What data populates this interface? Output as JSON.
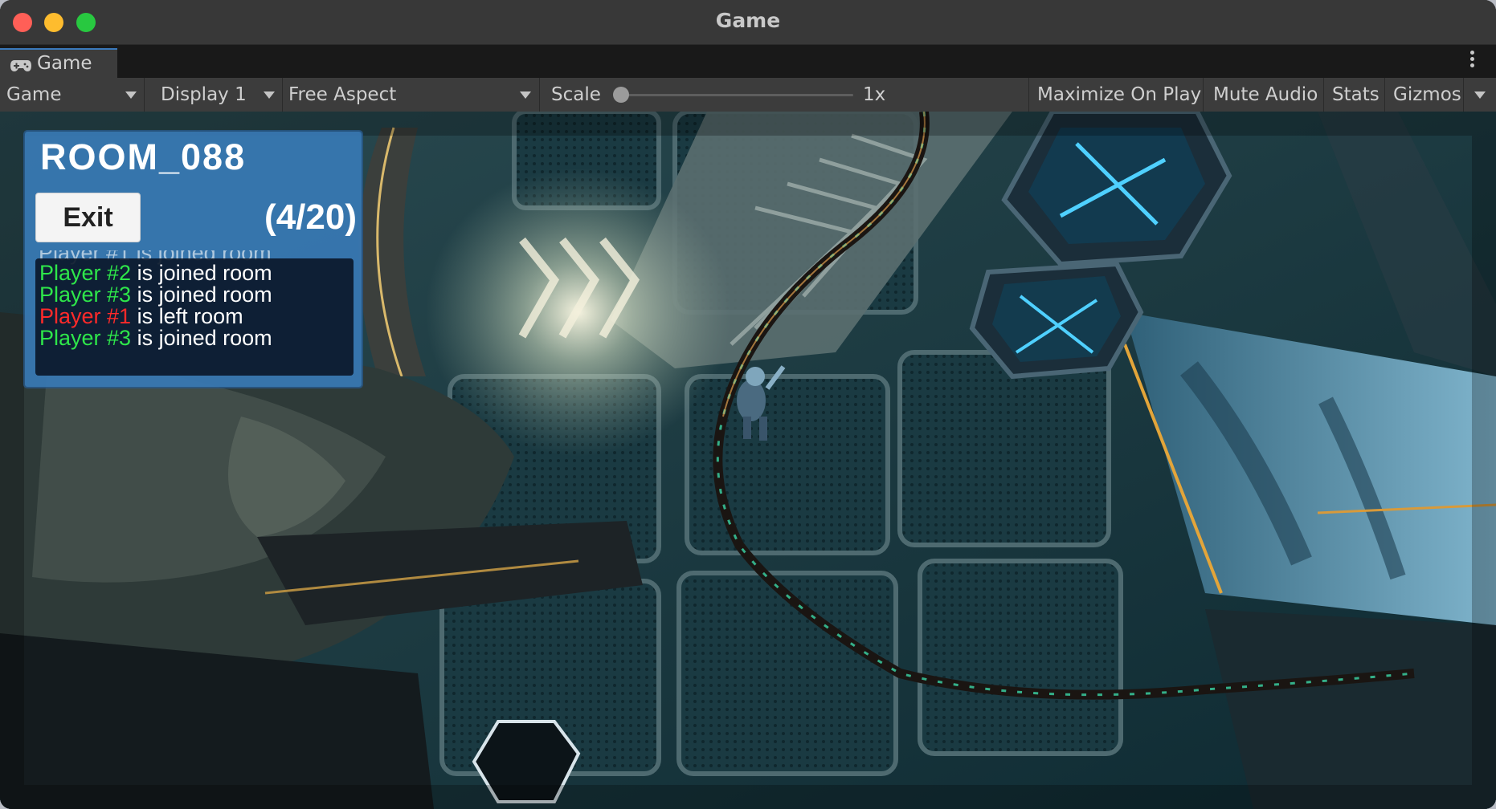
{
  "window": {
    "title": "Game"
  },
  "tab": {
    "label": "Game",
    "icon": "gamepad-icon"
  },
  "toolbar": {
    "mode": "Game",
    "display": "Display 1",
    "aspect": "Free Aspect",
    "scale_label": "Scale",
    "scale_value": "1x",
    "maximize": "Maximize On Play",
    "mute": "Mute Audio",
    "stats": "Stats",
    "gizmos": "Gizmos"
  },
  "room": {
    "name": "ROOM_088",
    "exit_label": "Exit",
    "count": "(4/20)",
    "log_ghost": "Player #1 is joined room",
    "log": [
      {
        "player": "Player #2",
        "action": " is joined room",
        "color": "#2ee64a"
      },
      {
        "player": "Player #3",
        "action": " is joined room",
        "color": "#2ee64a"
      },
      {
        "player": "Player #1",
        "action": " is left room",
        "color": "#ff2a2a"
      },
      {
        "player": "Player #3",
        "action": " is joined room",
        "color": "#2ee64a"
      }
    ]
  }
}
